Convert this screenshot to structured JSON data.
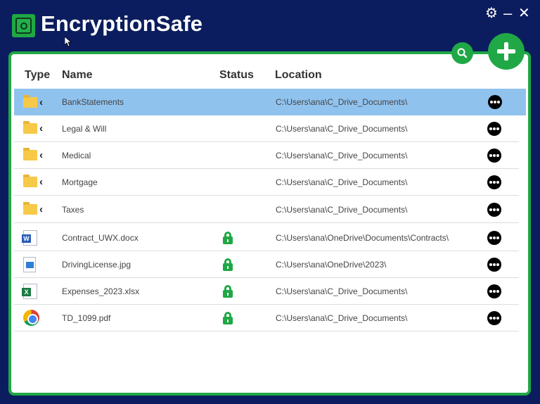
{
  "app": {
    "title": "EncryptionSafe",
    "accent_color": "#1fa845",
    "background_color": "#0b1d5e",
    "selected_row_color": "#90c2ee"
  },
  "window_controls": {
    "settings_icon": "gear-icon",
    "minimize_icon": "minimize-icon",
    "close_icon": "close-icon"
  },
  "toolbar": {
    "search_icon": "search-icon",
    "add_icon": "plus-icon"
  },
  "table": {
    "columns": [
      "Type",
      "Name",
      "Status",
      "Location"
    ],
    "rows": [
      {
        "type": "folder",
        "name": "BankStatements",
        "status": "",
        "location": "C:\\Users\\ana\\C_Drive_Documents\\",
        "selected": true
      },
      {
        "type": "folder",
        "name": "Legal & Will",
        "status": "",
        "location": "C:\\Users\\ana\\C_Drive_Documents\\"
      },
      {
        "type": "folder",
        "name": "Medical",
        "status": "",
        "location": "C:\\Users\\ana\\C_Drive_Documents\\"
      },
      {
        "type": "folder",
        "name": "Mortgage",
        "status": "",
        "location": "C:\\Users\\ana\\C_Drive_Documents\\"
      },
      {
        "type": "folder",
        "name": "Taxes",
        "status": "",
        "location": "C:\\Users\\ana\\C_Drive_Documents\\"
      },
      {
        "type": "word-document",
        "name": "Contract_UWX.docx",
        "status": "locked",
        "location": "C:\\Users\\ana\\OneDrive\\Documents\\Contracts\\"
      },
      {
        "type": "image",
        "name": "DrivingLicense.jpg",
        "status": "locked",
        "location": "C:\\Users\\ana\\OneDrive\\2023\\"
      },
      {
        "type": "excel-spreadsheet",
        "name": "Expenses_2023.xlsx",
        "status": "locked",
        "location": "C:\\Users\\ana\\C_Drive_Documents\\"
      },
      {
        "type": "chrome-pdf",
        "name": "TD_1099.pdf",
        "status": "locked",
        "location": "C:\\Users\\ana\\C_Drive_Documents\\"
      }
    ]
  }
}
